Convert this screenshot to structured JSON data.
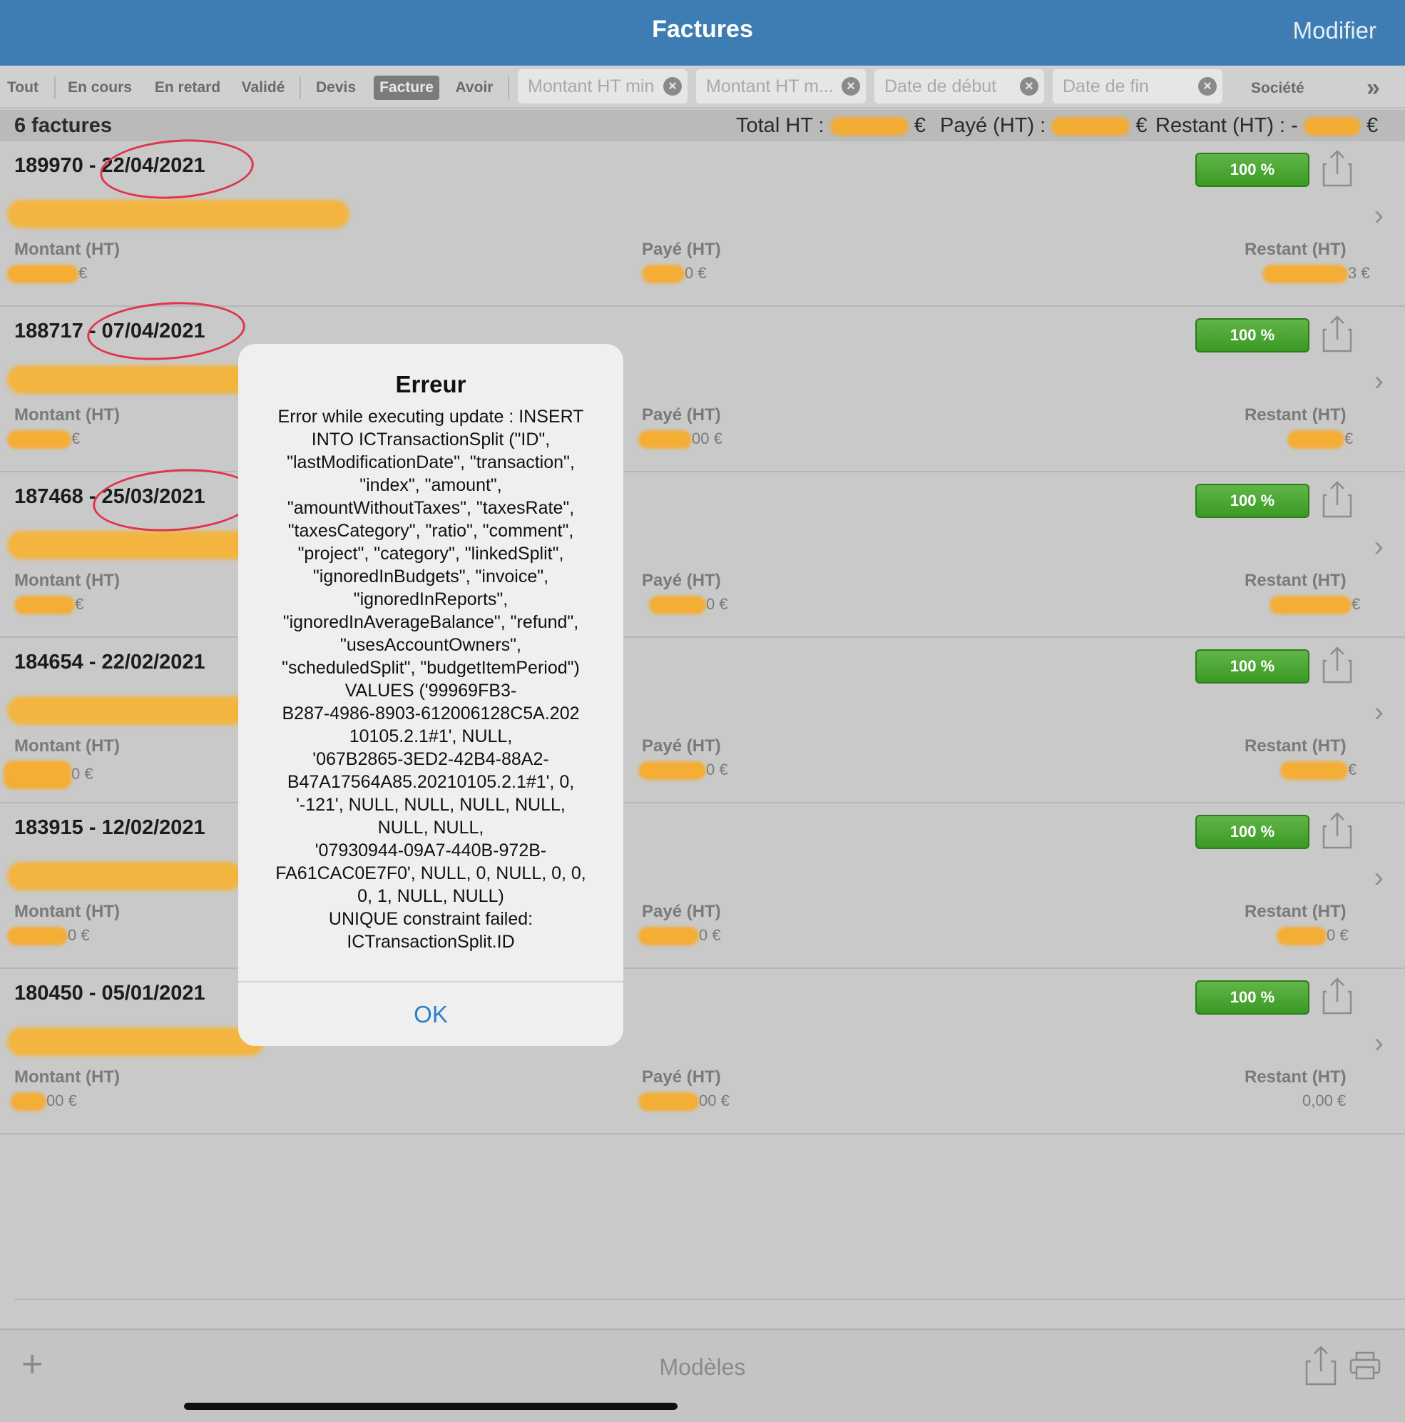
{
  "navbar": {
    "title": "Factures",
    "edit_label": "Modifier"
  },
  "filters": {
    "segments": [
      "Tout",
      "En cours",
      "En retard",
      "Validé",
      "Devis",
      "Facture",
      "Avoir"
    ],
    "active_segment": "Facture",
    "fields": [
      {
        "placeholder": "Montant HT min"
      },
      {
        "placeholder": "Montant HT m..."
      },
      {
        "placeholder": "Date de début"
      },
      {
        "placeholder": "Date de fin"
      }
    ],
    "company_label": "Société"
  },
  "summary": {
    "count": "6 factures",
    "total_label": "Total HT :",
    "paid_label": "Payé (HT) :",
    "remaining_label": "Restant (HT) : -",
    "currency": "€"
  },
  "invoices": [
    {
      "title": "189970 - 22/04/2021",
      "percent": "100 %",
      "amount_label": "Montant (HT)",
      "paid_label": "Payé (HT)",
      "remaining_label": "Restant (HT)",
      "paid_value": "0 €",
      "remaining_value": "3 €",
      "amount_value": "€"
    },
    {
      "title": "188717 - 07/04/2021",
      "percent": "100 %",
      "amount_label": "Montant (HT)",
      "paid_label": "Payé (HT)",
      "remaining_label": "Restant (HT)",
      "paid_value": "00 €",
      "remaining_value": "€",
      "amount_value": "€"
    },
    {
      "title": "187468 - 25/03/2021",
      "percent": "100 %",
      "amount_label": "Montant (HT)",
      "paid_label": "Payé (HT)",
      "remaining_label": "Restant (HT)",
      "paid_value": "0 €",
      "remaining_value": "€",
      "amount_value": "€"
    },
    {
      "title": "184654 - 22/02/2021",
      "percent": "100 %",
      "amount_label": "Montant (HT)",
      "paid_label": "Payé (HT)",
      "remaining_label": "Restant (HT)",
      "paid_value": "0 €",
      "remaining_value": "€",
      "amount_value": "0 €"
    },
    {
      "title": "183915 - 12/02/2021",
      "percent": "100 %",
      "amount_label": "Montant (HT)",
      "paid_label": "Payé (HT)",
      "remaining_label": "Restant (HT)",
      "paid_value": "0 €",
      "remaining_value": "0 €",
      "amount_value": "0 €"
    },
    {
      "title": "180450 - 05/01/2021",
      "percent": "100 %",
      "amount_label": "Montant (HT)",
      "paid_label": "Payé (HT)",
      "remaining_label": "Restant (HT)",
      "paid_value": "00 €",
      "remaining_value": "0,00 €",
      "amount_value": "00 €"
    }
  ],
  "alert": {
    "title": "Erreur",
    "message": "Error while executing update : INSERT\nINTO ICTransactionSplit (\"ID\",\n\"lastModificationDate\", \"transaction\",\n\"index\", \"amount\",\n\"amountWithoutTaxes\", \"taxesRate\",\n\"taxesCategory\", \"ratio\", \"comment\",\n\"project\", \"category\", \"linkedSplit\",\n\"ignoredInBudgets\", \"invoice\",\n\"ignoredInReports\",\n\"ignoredInAverageBalance\", \"refund\",\n\"usesAccountOwners\",\n\"scheduledSplit\", \"budgetItemPeriod\")\nVALUES ('99969FB3-\nB287-4986-8903-612006128C5A.202\n10105.2.1#1', NULL,\n'067B2865-3ED2-42B4-88A2-\nB47A17564A85.20210105.2.1#1', 0,\n'-121', NULL, NULL, NULL, NULL,\nNULL, NULL,\n'07930944-09A7-440B-972B-\nFA61CAC0E7F0', NULL, 0, NULL, 0, 0,\n0, 1, NULL, NULL)\nUNIQUE constraint failed:\nICTransactionSplit.ID",
    "ok_label": "OK"
  },
  "toolbar": {
    "models_label": "Modèles"
  },
  "colors": {
    "nav": "#3d7db3",
    "badge_green": "#4aa832",
    "alert_button": "#2f7ec8",
    "annotation_red": "#e0344a",
    "redaction": "#f7b230"
  }
}
